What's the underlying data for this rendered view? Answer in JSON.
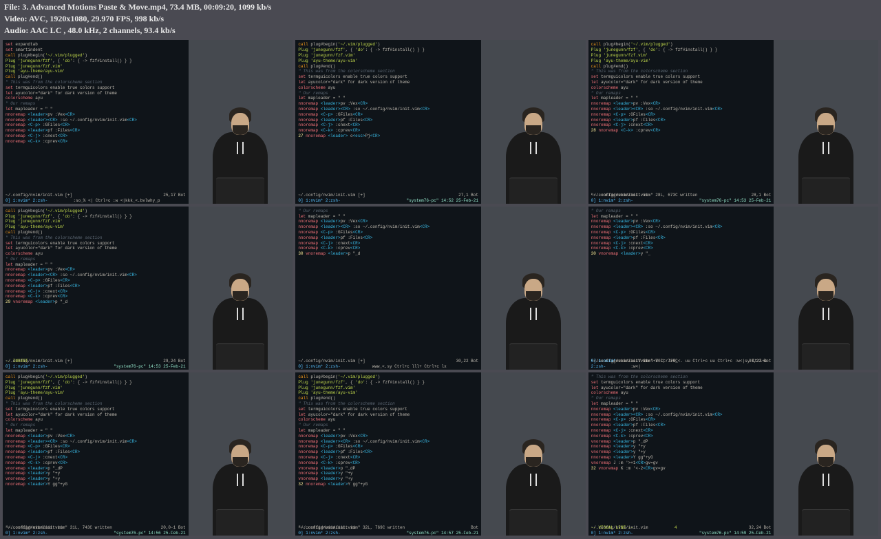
{
  "header": {
    "file_label": "File: ",
    "file_value": "3. Advanced Motions Paste & Move.mp4, 73.4 MB, 00:09:20, 1099 kb/s",
    "video_label": "Video: ",
    "video_value": "AVC, 1920x1080, 29.970 FPS, 998 kb/s",
    "audio_label": "Audio: ",
    "audio_value": "AAC LC , 48.0 kHz, 2 channels, 93.4 kb/s"
  },
  "common": {
    "filepath": "~/.config/nvim/init.vim",
    "tabbar": "0] 1:nvim* 2:zsh-",
    "sysinfo_prefix": "\"system76-pc\" ",
    "bot": "Bot",
    "plug_begin": "call plug#begin('~/.vim/plugged')",
    "plug_fzf": "Plug 'junegunn/fzf', { 'do': { -> fzf#install() } }",
    "plug_fzfvim": "Plug 'junegunn/fzf.vim'",
    "plug_ayu": "Plug 'ayu-theme/ayu-vim'",
    "plug_end": "call plug#end()",
    "cs_comment": "\" This was from the colorscheme section",
    "set_tgc": "set termguicolors",
    "tgc_comment": "\" enable true colors support",
    "let_ayu": "let ayucolor=\"dark\"",
    "ayu_comment": "\" for dark version of theme",
    "colorscheme": "colorscheme ayu",
    "remaps_comment": "\" Our remaps",
    "mapleader": "let mapleader = \" \"",
    "nno_pv": "nnoremap <leader>pv :Vex<CR>",
    "nno_cr": "nnoremap <leader><CR> :so ~/.config/nvim/init.vim<CR>",
    "nno_gf": "nnoremap <C-p> :GFiles<CR>",
    "nno_pf": "nnoremap <leader>pf :Files<CR>",
    "nno_cj": "nnoremap <C-j> :cnext<CR>",
    "nno_ck": "nnoremap <C-k> :cprev<CR>"
  },
  "cells": [
    {
      "extra_top": [
        "set expandtab",
        "set smartindent"
      ],
      "status_file": "~/.config/nvim/init.vim [+]",
      "status_pos": "25,17",
      "cmdline_left": ":so_% <| Ctrl+c :w <|kkk_<.bvlwhy_p",
      "cmdline_right": ""
    },
    {
      "extra_bottom": [
        "nnoremap <leader> o<esc>Pj<CR>"
      ],
      "linenum_hl": "27",
      "status_file": "~/.config/nvim/init.vim [+]",
      "status_pos": "27,1",
      "cmdline_left": "",
      "cmdline_right": "14:52 25-Feb-21"
    },
    {
      "linenum_hl": "28",
      "status_file": "~/.config/nvim/init.vim",
      "status_pos": "28,1",
      "written": "\"~/.config/nvim/init.vim\" 28L, 673C written",
      "cmdline_right": "14:53 25-Feb-21"
    },
    {
      "extra_bottom": [
        "vnoremap <leader>p \"_d"
      ],
      "linenum_hl": "29",
      "status_file": "~/.config/nvim/init.vim [+]",
      "status_pos": "29,24",
      "insert": "-- INSERT --",
      "cmdline_right": "14:53 25-Feb-21"
    },
    {
      "extra_bottom": [
        "vnoremap <leader>p \"_d"
      ],
      "linenum_hl": "30",
      "status_file": "~/.config/nvim/init.vim [+]",
      "status_pos": "30,22",
      "cmdline_left": "www_<.sy Ctrl+c lll+ Ctrl+c lx",
      "cmdline_right": ""
    },
    {
      "extra_bottom": [
        "vnoremap <leader>y \"_"
      ],
      "linenum_hl": "30",
      "status_file": "~/.config/nvim/init.vim",
      "status_pos": "30,22",
      "written": "\"~/.config/nvim/init.vim\" 30L, 720C",
      "cmdline_left": "...V Ctrl+V Ctrl+V_<. uu Ctrl+c uu Ctrl+c :w<|sy Ctrl+c :w<|",
      "cmdline_right": ""
    },
    {
      "extra_bottom": [
        "vnoremap <leader>p \"_dP",
        "nnoremap <leader>y \"+y",
        "vnoremap <leader>y \"+y",
        "nnoremap <leader>Y gg\"+yG"
      ],
      "status_file": "~/.config/nvim/init.vim",
      "status_pos": "20,0-1",
      "written": "\"~/.config/nvim/init.vim\" 31L, 743C written",
      "cmdline_right": "14:56 25-Feb-21"
    },
    {
      "extra_bottom": [
        "vnoremap <leader>p \"_dP",
        "nnoremap <leader>y \"+y",
        "vnoremap <leader>y \"+y",
        "nnoremap <leader>Y gg\"+yG"
      ],
      "linenum_hl": "32",
      "status_file": "~/.config/nvim/init.vim",
      "status_pos": "",
      "written": "\"~/.config/nvim/init.vim\" 32L, 769C written",
      "cmdline_right": "14:57 25-Feb-21"
    },
    {
      "extra_bottom": [
        "vnoremap <leader>p \"_dP",
        "nnoremap <leader>y \"+y",
        "vnoremap <leader>y \"+y",
        "nnoremap <leader>Y gg\"+yG",
        "",
        "vnoremap J :m '>+1<CR>gv=gv",
        "vnoremap K :m '<-2<CR>gv=gv"
      ],
      "linenum_hl": "32",
      "status_file": "~/.config/nvim/init.vim",
      "status_pos": "32,24",
      "visual": "-- VISUAL LINE --",
      "visual_count": "4",
      "cmdline_right": "14:59 25-Feb-21"
    }
  ]
}
